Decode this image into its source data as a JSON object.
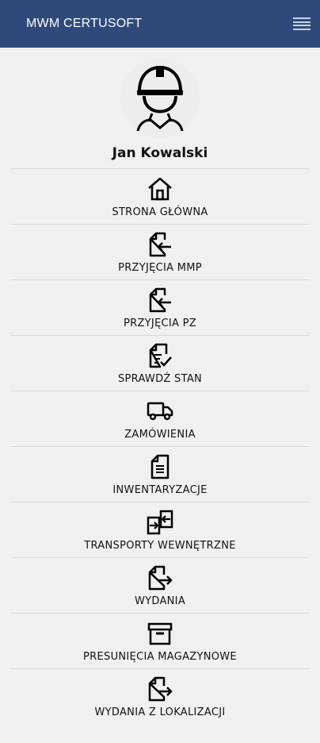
{
  "header": {
    "title": "MWM CERTUSOFT",
    "menu_icon": "hamburger-icon",
    "background": "#2f4a7a"
  },
  "profile": {
    "name": "Jan Kowalski",
    "avatar_icon": "worker-helmet-icon"
  },
  "menu": [
    {
      "label": "STRONA GŁÓWNA",
      "icon": "home-icon"
    },
    {
      "label": "PRZYJĘCIA MMP",
      "icon": "document-incoming-icon"
    },
    {
      "label": "PRZYJĘCIA PZ",
      "icon": "document-incoming-icon"
    },
    {
      "label": "SPRAWDŹ STAN",
      "icon": "document-check-icon"
    },
    {
      "label": "ZAMÓWIENIA",
      "icon": "truck-icon"
    },
    {
      "label": "INWENTARYZACJE",
      "icon": "document-list-icon"
    },
    {
      "label": "TRANSPORTY WEWNĘTRZNE",
      "icon": "transfer-icon"
    },
    {
      "label": "WYDANIA",
      "icon": "document-outgoing-icon"
    },
    {
      "label": "PRESUNIĘCIA MAGAZYNOWE",
      "icon": "archive-box-icon"
    },
    {
      "label": "WYDANIA Z LOKALIZACJI",
      "icon": "document-outgoing-icon"
    }
  ]
}
